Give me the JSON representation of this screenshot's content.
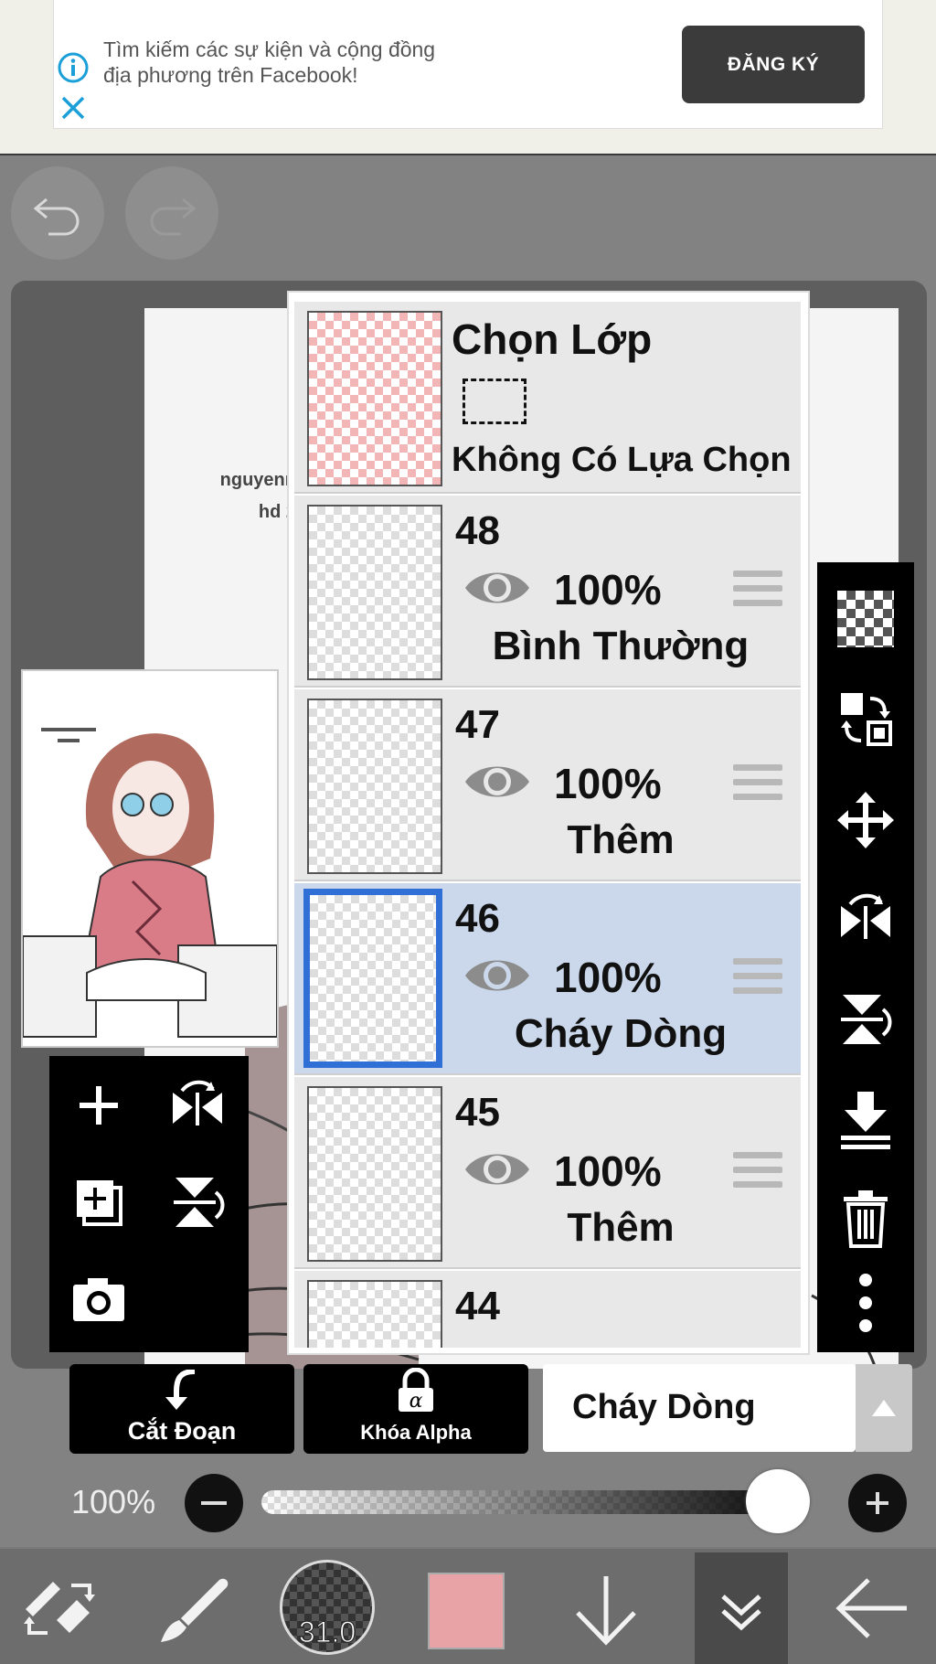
{
  "ad": {
    "text_line1": "Tìm kiếm các sự kiện và cộng đồng",
    "text_line2": "địa phương trên Facebook!",
    "button_label": "ĐĂNG KÝ"
  },
  "canvas": {
    "paper_text_line1": "nguyenn",
    "paper_text_line2": "hd 2"
  },
  "layer_panel": {
    "selection_layer": {
      "title": "Chọn Lớp",
      "status": "Không Có Lựa Chọn"
    },
    "layers": [
      {
        "number": "48",
        "opacity": "100%",
        "blend_mode": "Bình Thường",
        "selected": false
      },
      {
        "number": "47",
        "opacity": "100%",
        "blend_mode": "Thêm",
        "selected": false
      },
      {
        "number": "46",
        "opacity": "100%",
        "blend_mode": "Cháy Dòng",
        "selected": true
      },
      {
        "number": "45",
        "opacity": "100%",
        "blend_mode": "Thêm",
        "selected": false
      },
      {
        "number": "44",
        "opacity": "",
        "blend_mode": "",
        "selected": false
      }
    ]
  },
  "bottom_controls": {
    "clipping_label": "Cắt Đoạn",
    "alpha_lock_label": "Khóa Alpha",
    "blend_mode_value": "Cháy Dòng",
    "opacity_label": "100%",
    "opacity_fraction": 1.0
  },
  "toolbar": {
    "brush_size": "31.0",
    "color_hex": "#e8a3a6"
  },
  "colors": {
    "selected_layer_bg": "#cbd8ec",
    "selected_layer_border": "#2f6fd6",
    "ad_button_bg": "#3b3b3b"
  }
}
